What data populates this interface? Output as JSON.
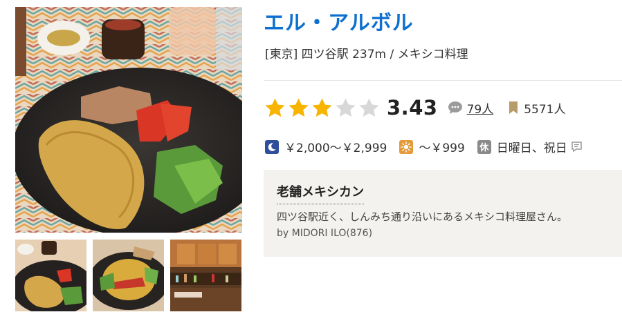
{
  "restaurant": {
    "name": "エル・アルボル",
    "location": "[東京] 四ツ谷駅 237m / メキシコ料理"
  },
  "rating": {
    "score": "3.43",
    "stars_value": 3.43,
    "reviews_count": "79人",
    "bookmarks_count": "5571人"
  },
  "prices": {
    "dinner": "￥2,000～￥2,999",
    "lunch": "～￥999",
    "closed_badge": "休",
    "closed_days": "日曜日、祝日"
  },
  "pr": {
    "heading": "老舗メキシカン",
    "body": "四ツ谷駅近く、しんみち通り沿いにあるメキシコ料理屋さん。",
    "author": "by MIDORI ILO(876)"
  },
  "icons": {
    "dinner": "moon-icon",
    "lunch": "sun-icon",
    "reviews": "comment-icon",
    "bookmarks": "bookmark-icon",
    "note": "note-icon"
  },
  "colors": {
    "title": "#0d6fd0",
    "star_filled": "#f7b500",
    "star_empty": "#d8d8d8",
    "dinner_icon": "#2f4f9a",
    "lunch_icon": "#e39a3b",
    "pr_background": "#f4f2ee"
  }
}
